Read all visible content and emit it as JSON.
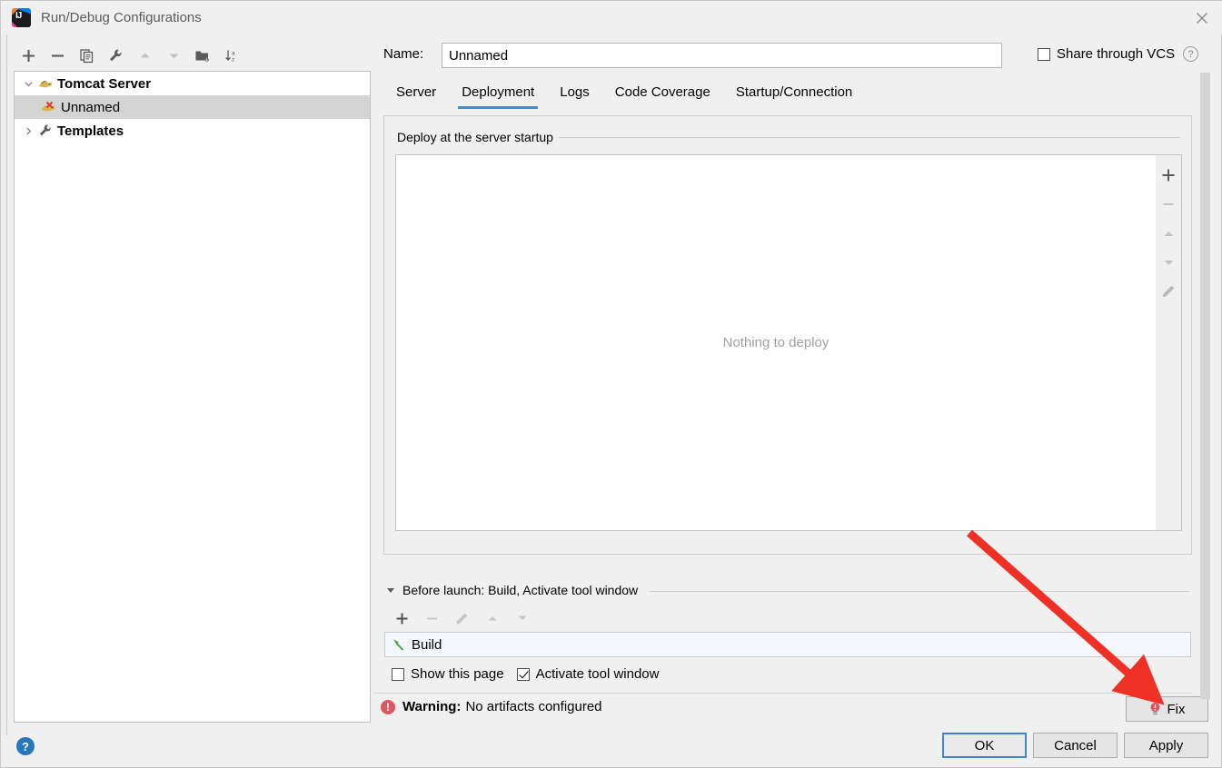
{
  "window": {
    "title": "Run/Debug Configurations",
    "app_icon": "intellij-idea-icon",
    "close_icon": "close-icon"
  },
  "left_toolbar": {
    "items": [
      {
        "name": "add-configuration-button",
        "icon": "plus-icon",
        "enabled": true
      },
      {
        "name": "remove-configuration-button",
        "icon": "minus-icon",
        "enabled": true
      },
      {
        "name": "copy-configuration-button",
        "icon": "copy-icon",
        "enabled": true
      },
      {
        "name": "edit-templates-button",
        "icon": "wrench-icon",
        "enabled": true
      },
      {
        "name": "move-up-button",
        "icon": "arrow-up-icon",
        "enabled": false
      },
      {
        "name": "move-down-button",
        "icon": "arrow-down-icon",
        "enabled": false
      },
      {
        "name": "create-folder-button",
        "icon": "folder-add-icon",
        "enabled": true
      },
      {
        "name": "sort-alphabetically-button",
        "icon": "sort-az-icon",
        "enabled": true
      }
    ]
  },
  "tree": {
    "nodes": [
      {
        "label": "Tomcat Server",
        "icon": "tomcat-icon",
        "expander": "chevron-down-icon",
        "level": 0,
        "bold": true,
        "selected": false,
        "error": false
      },
      {
        "label": "Unnamed",
        "icon": "tomcat-error-icon",
        "expander": "",
        "level": 1,
        "bold": false,
        "selected": true,
        "error": true
      },
      {
        "label": "Templates",
        "icon": "wrench-icon",
        "expander": "chevron-right-icon",
        "level": 0,
        "bold": true,
        "selected": false,
        "error": false
      }
    ]
  },
  "help_button": {
    "label": "?",
    "name": "help-button"
  },
  "name_field": {
    "label": "Name:",
    "value": "Unnamed",
    "placeholder": "Unnamed"
  },
  "share_vcs": {
    "label": "Share through VCS",
    "checked": false,
    "help_icon": "question-mark-icon"
  },
  "tabs": [
    {
      "label": "Server",
      "active": false
    },
    {
      "label": "Deployment",
      "active": true
    },
    {
      "label": "Logs",
      "active": false
    },
    {
      "label": "Code Coverage",
      "active": false
    },
    {
      "label": "Startup/Connection",
      "active": false
    }
  ],
  "deployment": {
    "group_title": "Deploy at the server startup",
    "empty_text": "Nothing to deploy",
    "side_toolbar": [
      {
        "name": "add-artifact-button",
        "icon": "plus-icon",
        "enabled": true
      },
      {
        "name": "remove-artifact-button",
        "icon": "minus-icon",
        "enabled": false
      },
      {
        "name": "move-artifact-up-button",
        "icon": "arrow-up-icon",
        "enabled": false
      },
      {
        "name": "move-artifact-down-button",
        "icon": "arrow-down-icon",
        "enabled": false
      },
      {
        "name": "edit-artifact-button",
        "icon": "pencil-icon",
        "enabled": false
      }
    ]
  },
  "before_launch": {
    "header": "Before launch: Build, Activate tool window",
    "expander": "triangle-down-icon",
    "toolbar": [
      {
        "name": "add-task-button",
        "icon": "plus-icon",
        "enabled": true
      },
      {
        "name": "remove-task-button",
        "icon": "minus-icon",
        "enabled": false
      },
      {
        "name": "edit-task-button",
        "icon": "pencil-icon",
        "enabled": false
      },
      {
        "name": "move-task-up-button",
        "icon": "arrow-up-icon",
        "enabled": false
      },
      {
        "name": "move-task-down-button",
        "icon": "arrow-down-icon",
        "enabled": false
      }
    ],
    "tasks": [
      {
        "label": "Build",
        "icon": "hammer-icon"
      }
    ],
    "checkboxes": [
      {
        "label": "Show this page",
        "checked": false
      },
      {
        "label": "Activate tool window",
        "checked": true
      }
    ]
  },
  "warning": {
    "icon": "error-circle-icon",
    "prefix": "Warning:",
    "message": "No artifacts configured"
  },
  "buttons": {
    "fix": {
      "label": "Fix",
      "icon": "lightbulb-error-icon"
    },
    "ok": {
      "label": "OK",
      "focused": true
    },
    "cancel": {
      "label": "Cancel"
    },
    "apply": {
      "label": "Apply"
    }
  },
  "annotation": {
    "type": "red-arrow",
    "color": "#ee3124",
    "points_to": "fix-button"
  },
  "colors": {
    "accent_blue": "#4a88c7",
    "focus_blue": "#3d85d0",
    "dialog_bg": "#f0f0f0",
    "selection_gray": "#d4d4d4",
    "warning_red": "#db5860",
    "annotation_red": "#ee3124"
  }
}
